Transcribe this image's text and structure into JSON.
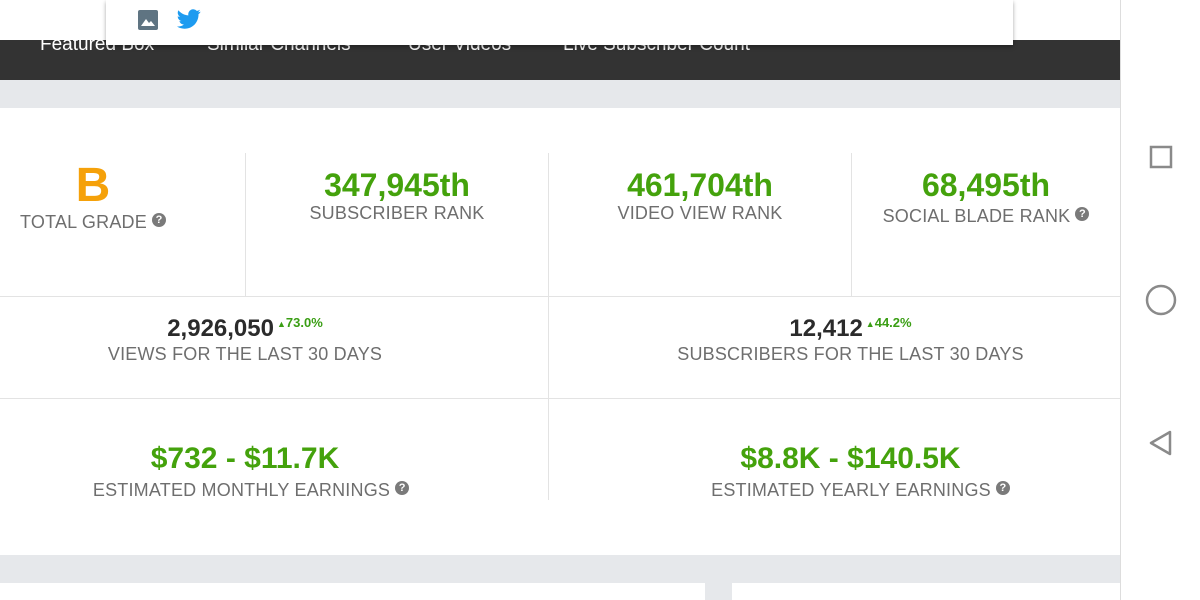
{
  "share": {
    "icons": [
      "image-icon",
      "twitter-icon"
    ]
  },
  "nav": {
    "items": [
      {
        "label": "Featured Box"
      },
      {
        "label": "Similar Channels"
      },
      {
        "label": "User Videos"
      },
      {
        "label": "Live Subscriber Count"
      }
    ]
  },
  "ranks": {
    "grade": {
      "value": "B",
      "label": "TOTAL GRADE"
    },
    "subscriber": {
      "value": "347,945th",
      "label": "SUBSCRIBER RANK"
    },
    "video_view": {
      "value": "461,704th",
      "label": "VIDEO VIEW RANK"
    },
    "social_blade": {
      "value": "68,495th",
      "label": "SOCIAL BLADE RANK"
    }
  },
  "last30": {
    "views": {
      "value": "2,926,050",
      "delta": "73.0%",
      "label": "VIEWS FOR THE LAST 30 DAYS"
    },
    "subscribers": {
      "value": "12,412",
      "delta": "44.2%",
      "label": "SUBSCRIBERS FOR THE LAST 30 DAYS"
    }
  },
  "earnings": {
    "monthly": {
      "value": "$732 - $11.7K",
      "label": "ESTIMATED MONTHLY EARNINGS"
    },
    "yearly": {
      "value": "$8.8K - $140.5K",
      "label": "ESTIMATED YEARLY EARNINGS"
    }
  },
  "help_glyph": "?",
  "delta_arrow": "▲",
  "colors": {
    "accent_green": "#44a20c",
    "grade_orange": "#f5a10a",
    "nav_bg": "#333333",
    "twitter_blue": "#1d9bf0"
  },
  "system_nav": {
    "buttons": [
      "recents-square-icon",
      "home-circle-icon",
      "back-triangle-icon"
    ]
  }
}
